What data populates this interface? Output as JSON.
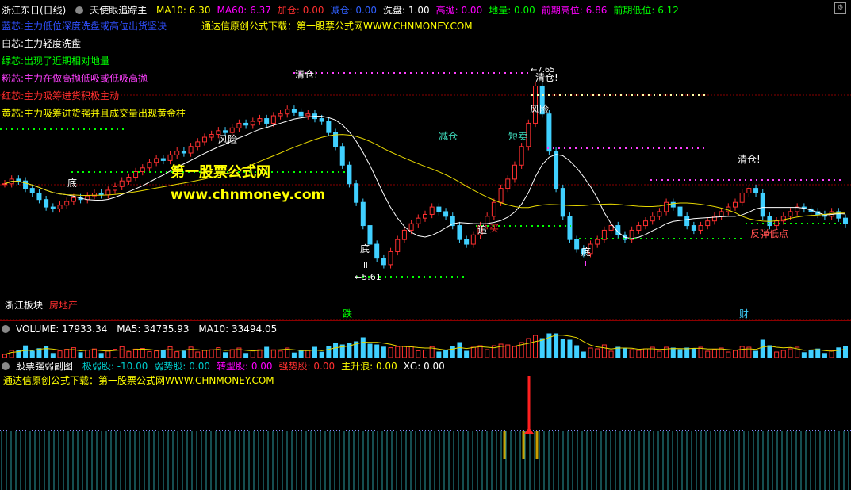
{
  "header": {
    "stock": "浙江东日(日线)",
    "indicator": "天使眼追踪主",
    "items": [
      {
        "label": "MA10: 6.30",
        "color": "#ffff00"
      },
      {
        "label": "MA60: 6.37",
        "color": "#ff00ff"
      },
      {
        "label": "加仓: 0.00",
        "color": "#ff3030"
      },
      {
        "label": "减仓: 0.00",
        "color": "#3060ff"
      },
      {
        "label": "洗盘: 1.00",
        "color": "#ffffff"
      },
      {
        "label": "高抛: 0.00",
        "color": "#ff00ff"
      },
      {
        "label": "地量: 0.00",
        "color": "#00ff00"
      },
      {
        "label": "前期高位: 6.86",
        "color": "#ff00ff"
      },
      {
        "label": "前期低位: 6.12",
        "color": "#00ff00"
      }
    ]
  },
  "legend": [
    {
      "text": "蓝芯:主力低位深度洗盘或高位出货坚决",
      "color": "#3050ff"
    },
    {
      "text": "白芯:主力轻度洗盘",
      "color": "#ffffff"
    },
    {
      "text": "绿芯:出现了近期相对地量",
      "color": "#00ff00"
    },
    {
      "text": "粉芯:主力在做高抛低吸或低吸高抛",
      "color": "#ff40ff"
    },
    {
      "text": "红芯:主力吸筹进货积极主动",
      "color": "#ff3030"
    },
    {
      "text": "黄芯:主力吸筹进货强并且成交量出现黄金柱",
      "color": "#ffff00"
    }
  ],
  "promo_line": "通达信原创公式下载：第一股票公式网WWW.CHNMONEY.COM",
  "watermark": {
    "title": "第一股票公式网",
    "url": "www.chnmoney.com"
  },
  "annotations": {
    "qingcang1": "清仓!",
    "qingcang2": "清仓!",
    "qingcang3": "清仓!",
    "fengxian1": "风险",
    "fengxian2": "风险",
    "di1": "底",
    "di2": "底",
    "di3": "底",
    "jiancang": "减仓",
    "duanmai": "短卖",
    "zhui": "追",
    "mai": "买",
    "iii": "III",
    "i": "I",
    "low_label": "←5.61",
    "high_label": "←7.65",
    "fantan": "反弹低点"
  },
  "sector": {
    "board": "浙江板块",
    "other": "房地产",
    "mid": "跌",
    "right": "财"
  },
  "volume": {
    "label": "VOLUME: 17933.34",
    "ma5": "MA5: 34735.93",
    "ma10": "MA10: 33494.05"
  },
  "strength": {
    "name": "股票强弱副图",
    "items": [
      {
        "label": "极弱股: -10.00",
        "color": "#00cccc"
      },
      {
        "label": "弱势股: 0.00",
        "color": "#00cccc"
      },
      {
        "label": "转型股: 0.00",
        "color": "#ff00ff"
      },
      {
        "label": "强势股: 0.00",
        "color": "#ff3030"
      },
      {
        "label": "主升浪: 0.00",
        "color": "#ffff00"
      },
      {
        "label": "XG: 0.00",
        "color": "#ffffff"
      }
    ]
  },
  "colors": {
    "up": "#ff3030",
    "down": "#40d0ff",
    "ma_short": "#ffffff",
    "ma_long": "#e8d800",
    "vol_ma": "#e8d800"
  },
  "chart_data": {
    "type": "candlestick",
    "closes": [
      6.55,
      6.6,
      6.58,
      6.5,
      6.45,
      6.38,
      6.3,
      6.28,
      6.32,
      6.36,
      6.4,
      6.38,
      6.42,
      6.45,
      6.43,
      6.48,
      6.52,
      6.58,
      6.62,
      6.68,
      6.72,
      6.78,
      6.82,
      6.8,
      6.86,
      6.9,
      6.88,
      6.95,
      7.0,
      7.05,
      7.08,
      7.12,
      7.1,
      7.15,
      7.2,
      7.18,
      7.22,
      7.25,
      7.2,
      7.28,
      7.3,
      7.35,
      7.32,
      7.28,
      7.3,
      7.25,
      7.22,
      7.1,
      6.95,
      6.75,
      6.55,
      6.35,
      6.1,
      5.9,
      5.75,
      5.68,
      5.82,
      5.95,
      6.05,
      6.12,
      6.18,
      6.22,
      6.3,
      6.25,
      6.2,
      6.1,
      5.95,
      5.9,
      6.0,
      6.1,
      6.2,
      6.35,
      6.5,
      6.6,
      6.75,
      6.95,
      7.2,
      7.6,
      7.3,
      6.9,
      6.5,
      6.2,
      5.95,
      5.85,
      5.8,
      5.9,
      5.95,
      6.05,
      6.1,
      6.0,
      5.95,
      6.05,
      6.1,
      6.15,
      6.2,
      6.25,
      6.35,
      6.3,
      6.2,
      6.1,
      6.05,
      6.1,
      6.15,
      6.2,
      6.25,
      6.3,
      6.35,
      6.45,
      6.5,
      6.45,
      6.2,
      6.1,
      6.15,
      6.2,
      6.25,
      6.3,
      6.28,
      6.25,
      6.22,
      6.2,
      6.25,
      6.18,
      6.12
    ],
    "volume_ma5": 34735.93,
    "volume_ma10": 33494.05,
    "volume_last": 17933.34
  }
}
